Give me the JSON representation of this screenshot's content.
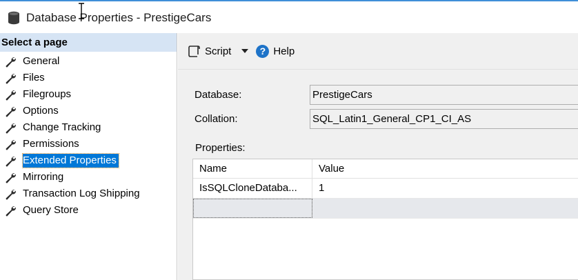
{
  "window": {
    "title": "Database Properties - PrestigeCars"
  },
  "sidebar": {
    "header": "Select a page",
    "items": [
      {
        "label": "General"
      },
      {
        "label": "Files"
      },
      {
        "label": "Filegroups"
      },
      {
        "label": "Options"
      },
      {
        "label": "Change Tracking"
      },
      {
        "label": "Permissions"
      },
      {
        "label": "Extended Properties",
        "selected": true
      },
      {
        "label": "Mirroring"
      },
      {
        "label": "Transaction Log Shipping"
      },
      {
        "label": "Query Store"
      }
    ]
  },
  "toolbar": {
    "script_label": "Script",
    "help_label": "Help",
    "help_glyph": "?"
  },
  "form": {
    "database_label": "Database:",
    "database_value": "PrestigeCars",
    "collation_label": "Collation:",
    "collation_value": "SQL_Latin1_General_CP1_CI_AS",
    "properties_label": "Properties:"
  },
  "grid": {
    "columns": [
      "Name",
      "Value"
    ],
    "rows": [
      {
        "name": "IsSQLCloneDataba...",
        "value": "1"
      }
    ]
  },
  "colors": {
    "selection": "#0078d7",
    "sidebar_header": "#d6e4f4",
    "help_icon": "#1e73c8",
    "title_accent": "#3f8fd8"
  }
}
